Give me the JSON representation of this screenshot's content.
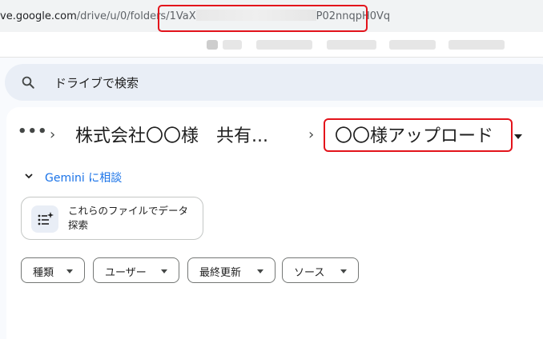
{
  "browser": {
    "url_prefix": "ve.google.com",
    "url_path": "/drive/u/0/folders/",
    "url_id_start": "1VaX",
    "url_id_end": "P02nnqpH0Vq"
  },
  "drive": {
    "search_placeholder": "ドライブで検索",
    "breadcrumb": {
      "more": "•••",
      "items": [
        "株式会社〇〇様　共有...",
        "〇〇様アップロード"
      ]
    },
    "gemini": {
      "brand": "Gemini",
      "suffix": " に相談",
      "card_text": "これらのファイルでデータ探索"
    },
    "filters": [
      "種類",
      "ユーザー",
      "最終更新",
      "ソース"
    ]
  },
  "colors": {
    "highlight": "#e3131b",
    "link": "#1a73e8"
  }
}
